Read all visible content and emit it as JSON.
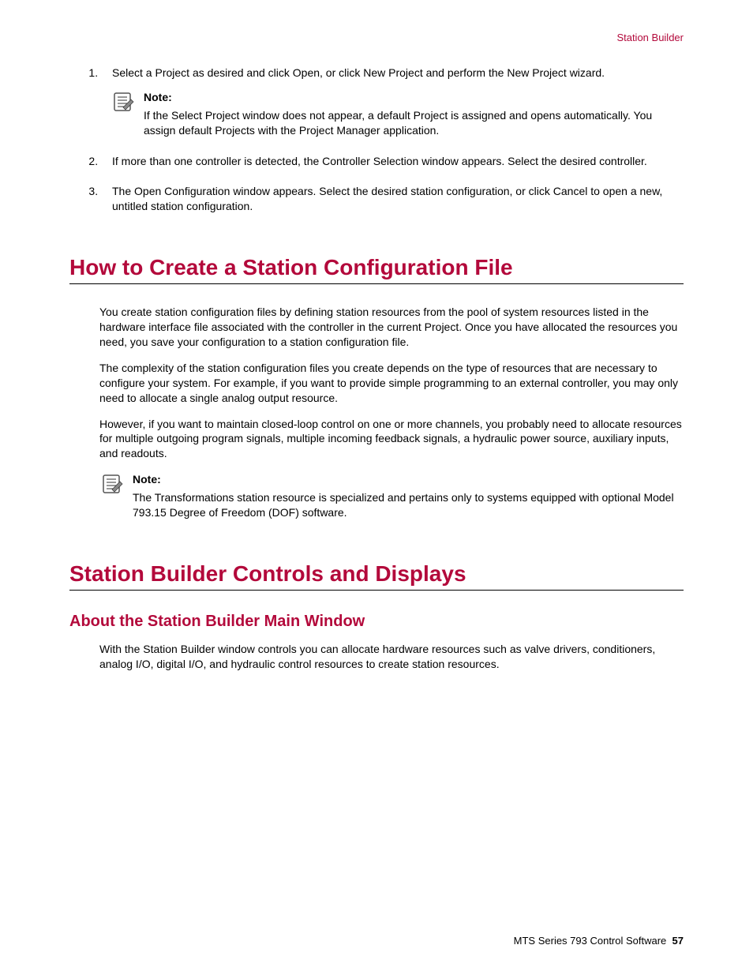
{
  "header": {
    "section_name": "Station Builder"
  },
  "steps": {
    "item1": "Select a Project as desired and click Open, or click New Project and perform the New Project wizard.",
    "note1_label": "Note:",
    "note1_body": "If the Select Project window does not appear, a default Project is assigned and opens automatically. You assign default Projects with the Project Manager application.",
    "item2": "If more than one controller is detected, the Controller Selection window appears. Select the desired controller.",
    "item3": "The Open Configuration window appears. Select the desired station configuration, or click Cancel to open a new, untitled station configuration."
  },
  "section1": {
    "title": "How to Create a Station Configuration File",
    "p1": "You create station configuration files by defining station resources from the pool of system resources listed in the hardware interface file associated with the controller in the current Project. Once you have allocated the resources you need, you save your configuration to a station configuration file.",
    "p2": "The complexity of the station configuration files you create depends on the type of resources that are necessary to configure your system. For example, if you want to provide simple programming to an external controller, you may only need to allocate a single analog output resource.",
    "p3": "However, if you want to maintain closed-loop control on one or more channels, you probably need to allocate resources for multiple outgoing program signals, multiple incoming feedback signals, a hydraulic power source, auxiliary inputs, and readouts.",
    "note_label": "Note:",
    "note_body": "The Transformations station resource is specialized and pertains only to systems equipped with optional Model 793.15 Degree of Freedom (DOF) software."
  },
  "section2": {
    "title": "Station Builder Controls and Displays",
    "sub1": "About the Station Builder Main Window",
    "p1": "With the Station Builder window controls you can allocate hardware resources such as valve drivers, conditioners, analog I/O, digital I/O, and hydraulic control resources to create station resources."
  },
  "footer": {
    "doc": "MTS Series 793 Control Software",
    "page": "57"
  }
}
